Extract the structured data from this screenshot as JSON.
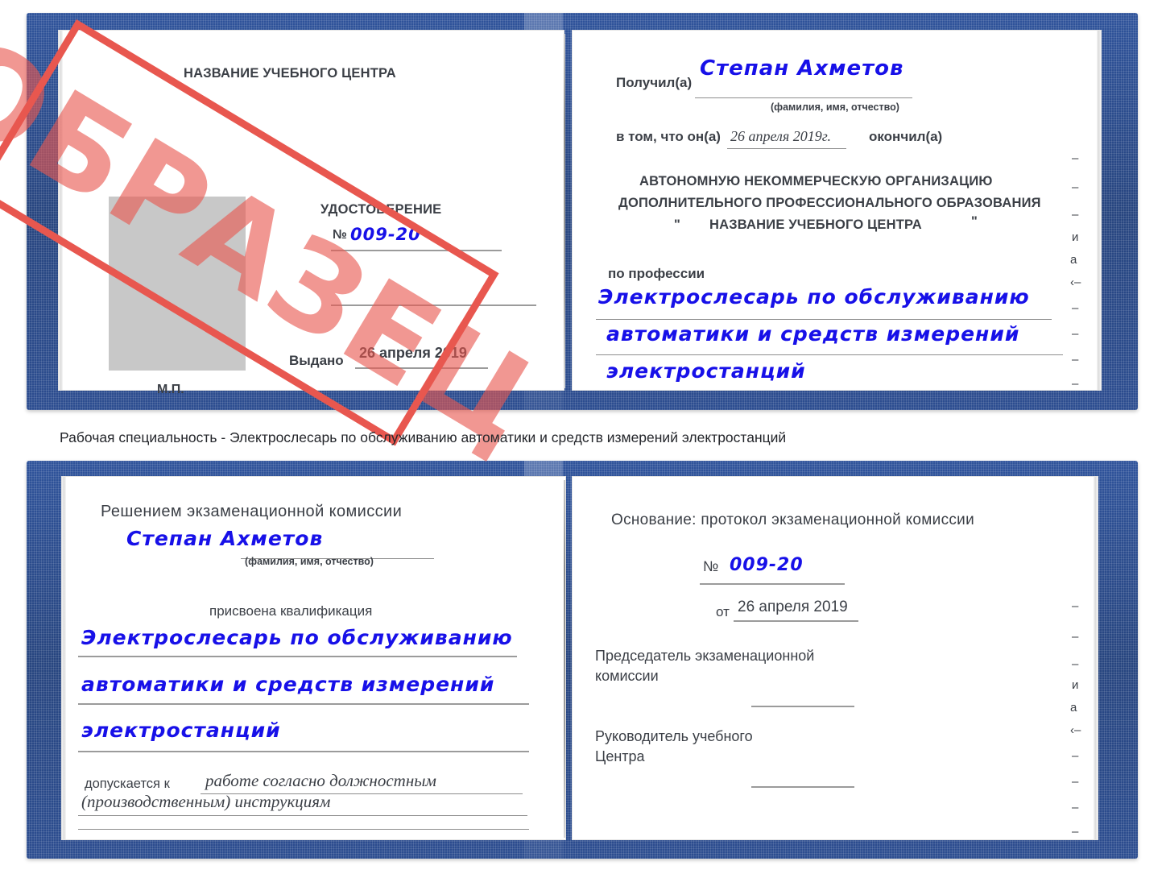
{
  "caption": {
    "text": "Рабочая специальность - Электрослесарь по обслуживанию автоматики и средств измерений электростанций"
  },
  "watermark": {
    "label": "ОБРАЗЕЦ",
    "color": "#e8574f"
  },
  "certificate_top": {
    "left_page": {
      "center_name": "НАЗВАНИЕ УЧЕБНОГО ЦЕНТРА",
      "doc_title": "УДОСТОВЕРЕНИЕ",
      "number_label": "№",
      "number_value": "009-20",
      "issued_label": "Выдано",
      "issued_value": "26 апреля 2019",
      "seal_label": "М.П."
    },
    "right_page": {
      "received_label": "Получил(а)",
      "received_value": "Степан Ахметов",
      "fio_hint": "(фамилия, имя, отчество)",
      "clause_prefix": "в том, что он(а)",
      "clause_date": "26 апреля 2019г.",
      "clause_suffix": "окончил(а)",
      "org_line1": "АВТОНОМНУЮ НЕКОММЕРЧЕСКУЮ ОРГАНИЗАЦИЮ",
      "org_line2": "ДОПОЛНИТЕЛЬНОГО ПРОФЕССИОНАЛЬНОГО ОБРАЗОВАНИЯ",
      "org_quote_open": "\"",
      "org_line3": "НАЗВАНИЕ УЧЕБНОГО ЦЕНТРА",
      "org_quote_close": "\"",
      "profession_label": "по профессии",
      "profession_line1": "Электрослесарь по обслуживанию",
      "profession_line2": "автоматики и средств измерений",
      "profession_line3": "электростанций",
      "edge_fragments": [
        "–",
        "–",
        "–",
        "и",
        "а",
        "‹–",
        "–",
        "–",
        "–",
        "–"
      ]
    }
  },
  "certificate_bottom": {
    "left_page": {
      "heading": "Решением экзаменационной комиссии",
      "name_value": "Степан Ахметов",
      "fio_hint": "(фамилия, имя, отчество)",
      "qualification_label": "присвоена квалификация",
      "qualification_line1": "Электрослесарь по обслуживанию",
      "qualification_line2": "автоматики и средств измерений",
      "qualification_line3": "электростанций",
      "admitted_label": "допускается к",
      "admitted_value_line1": "работе согласно должностным",
      "admitted_value_line2": "(производственным) инструкциям"
    },
    "right_page": {
      "basis_label": "Основание: протокол экзаменационной комиссии",
      "number_label": "№",
      "number_value": "009-20",
      "date_label": "от",
      "date_value": "26 апреля 2019",
      "chairman_line1": "Председатель экзаменационной",
      "chairman_line2": "комиссии",
      "head_line1": "Руководитель учебного",
      "head_line2": "Центра",
      "edge_fragments": [
        "–",
        "–",
        "–",
        "и",
        "а",
        "‹–",
        "–",
        "–",
        "–",
        "–"
      ]
    }
  }
}
